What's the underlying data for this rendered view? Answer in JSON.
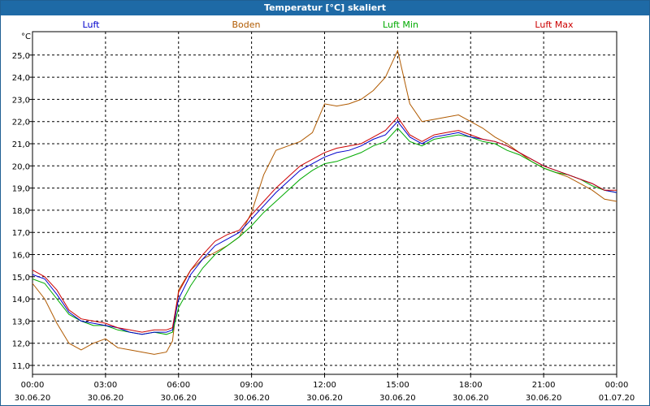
{
  "window": {
    "title": "Temperatur [°C] skaliert"
  },
  "colors": {
    "luft": "#0000cc",
    "boden": "#b05a00",
    "luft_min": "#00aa00",
    "luft_max": "#cc0000"
  },
  "chart_data": {
    "type": "line",
    "title": "Temperatur [°C] skaliert",
    "ylabel": "°C",
    "ylim": [
      10.8,
      26.0
    ],
    "xlim": [
      0,
      24
    ],
    "grid": true,
    "legend_position": "top",
    "y_ticks": [
      "11,0",
      "12,0",
      "13,0",
      "14,0",
      "15,0",
      "16,0",
      "17,0",
      "18,0",
      "19,0",
      "20,0",
      "21,0",
      "22,0",
      "23,0",
      "24,0",
      "25,0"
    ],
    "x_ticks": [
      {
        "time": "00:00",
        "date": "30.06.20"
      },
      {
        "time": "03:00",
        "date": "30.06.20"
      },
      {
        "time": "06:00",
        "date": "30.06.20"
      },
      {
        "time": "09:00",
        "date": "30.06.20"
      },
      {
        "time": "12:00",
        "date": "30.06.20"
      },
      {
        "time": "15:00",
        "date": "30.06.20"
      },
      {
        "time": "18:00",
        "date": "30.06.20"
      },
      {
        "time": "21:00",
        "date": "30.06.20"
      },
      {
        "time": "00:00",
        "date": "01.07.20"
      }
    ],
    "series": [
      {
        "name": "Luft",
        "color": "#0000cc",
        "x": [
          0,
          0.5,
          1.0,
          1.5,
          2.0,
          2.5,
          3.0,
          3.5,
          4.0,
          4.5,
          5.0,
          5.5,
          5.75,
          6.0,
          6.5,
          7.0,
          7.5,
          8.0,
          8.5,
          9.0,
          9.5,
          10.0,
          10.5,
          11.0,
          11.5,
          12.0,
          12.5,
          13.0,
          13.5,
          14.0,
          14.5,
          15.0,
          15.5,
          16.0,
          16.5,
          17.0,
          17.5,
          18.0,
          18.5,
          19.0,
          19.5,
          20.0,
          20.5,
          21.0,
          21.5,
          22.0,
          22.5,
          23.0,
          23.5,
          24.0
        ],
        "y": [
          15.1,
          14.9,
          14.2,
          13.4,
          13.0,
          12.9,
          12.8,
          12.7,
          12.5,
          12.4,
          12.5,
          12.5,
          12.6,
          14.0,
          15.1,
          15.8,
          16.4,
          16.7,
          17.0,
          17.6,
          18.2,
          18.8,
          19.3,
          19.8,
          20.1,
          20.4,
          20.6,
          20.7,
          20.9,
          21.2,
          21.4,
          22.0,
          21.3,
          21.0,
          21.3,
          21.4,
          21.5,
          21.3,
          21.2,
          21.1,
          20.9,
          20.6,
          20.3,
          20.0,
          19.8,
          19.6,
          19.4,
          19.2,
          18.9,
          18.8
        ]
      },
      {
        "name": "Boden",
        "color": "#b05a00",
        "x": [
          0,
          0.5,
          1.0,
          1.5,
          2.0,
          2.5,
          3.0,
          3.5,
          4.0,
          4.5,
          5.0,
          5.5,
          5.75,
          6.0,
          6.5,
          7.0,
          7.5,
          8.0,
          8.5,
          9.0,
          9.5,
          10.0,
          10.5,
          11.0,
          11.5,
          12.0,
          12.5,
          13.0,
          13.5,
          14.0,
          14.5,
          15.0,
          15.5,
          16.0,
          16.5,
          17.0,
          17.5,
          18.0,
          18.5,
          19.0,
          19.5,
          20.0,
          20.5,
          21.0,
          21.5,
          22.0,
          22.5,
          23.0,
          23.5,
          24.0
        ],
        "y": [
          14.7,
          14.0,
          12.9,
          12.0,
          11.7,
          12.0,
          12.2,
          11.8,
          11.7,
          11.6,
          11.5,
          11.6,
          12.1,
          14.4,
          15.3,
          15.8,
          16.1,
          16.4,
          16.8,
          17.9,
          19.6,
          20.7,
          20.9,
          21.1,
          21.5,
          22.8,
          22.7,
          22.8,
          23.0,
          23.4,
          24.0,
          25.2,
          22.8,
          22.0,
          22.1,
          22.2,
          22.3,
          22.0,
          21.7,
          21.3,
          21.0,
          20.6,
          20.2,
          19.9,
          19.7,
          19.5,
          19.2,
          18.9,
          18.5,
          18.4
        ]
      },
      {
        "name": "Luft Min",
        "color": "#00aa00",
        "x": [
          0,
          0.5,
          1.0,
          1.5,
          2.0,
          2.5,
          3.0,
          3.5,
          4.0,
          4.5,
          5.0,
          5.5,
          5.75,
          6.0,
          6.5,
          7.0,
          7.5,
          8.0,
          8.5,
          9.0,
          9.5,
          10.0,
          10.5,
          11.0,
          11.5,
          12.0,
          12.5,
          13.0,
          13.5,
          14.0,
          14.5,
          15.0,
          15.5,
          16.0,
          16.5,
          17.0,
          17.5,
          18.0,
          18.5,
          19.0,
          19.5,
          20.0,
          20.5,
          21.0,
          21.5,
          22.0,
          22.5,
          23.0,
          23.5,
          24.0
        ],
        "y": [
          14.9,
          14.7,
          14.0,
          13.3,
          13.0,
          12.8,
          12.8,
          12.6,
          12.5,
          12.4,
          12.5,
          12.4,
          12.5,
          13.6,
          14.6,
          15.4,
          16.0,
          16.4,
          16.8,
          17.3,
          17.9,
          18.4,
          18.9,
          19.4,
          19.8,
          20.1,
          20.2,
          20.4,
          20.6,
          20.9,
          21.1,
          21.7,
          21.1,
          20.9,
          21.2,
          21.3,
          21.4,
          21.3,
          21.1,
          21.0,
          20.7,
          20.5,
          20.2,
          19.9,
          19.7,
          19.6,
          19.4,
          19.1,
          18.9,
          18.8
        ]
      },
      {
        "name": "Luft Max",
        "color": "#cc0000",
        "x": [
          0,
          0.5,
          1.0,
          1.5,
          2.0,
          2.5,
          3.0,
          3.5,
          4.0,
          4.5,
          5.0,
          5.5,
          5.75,
          6.0,
          6.5,
          7.0,
          7.5,
          8.0,
          8.5,
          9.0,
          9.5,
          10.0,
          10.5,
          11.0,
          11.5,
          12.0,
          12.5,
          13.0,
          13.5,
          14.0,
          14.5,
          15.0,
          15.5,
          16.0,
          16.5,
          17.0,
          17.5,
          18.0,
          18.5,
          19.0,
          19.5,
          20.0,
          20.5,
          21.0,
          21.5,
          22.0,
          22.5,
          23.0,
          23.5,
          24.0
        ],
        "y": [
          15.3,
          15.0,
          14.4,
          13.5,
          13.1,
          13.0,
          12.9,
          12.7,
          12.6,
          12.5,
          12.6,
          12.6,
          12.7,
          14.3,
          15.3,
          16.0,
          16.6,
          16.9,
          17.1,
          17.8,
          18.4,
          19.0,
          19.5,
          20.0,
          20.3,
          20.6,
          20.8,
          20.9,
          21.0,
          21.3,
          21.6,
          22.2,
          21.4,
          21.1,
          21.4,
          21.5,
          21.6,
          21.4,
          21.2,
          21.1,
          20.9,
          20.6,
          20.3,
          20.0,
          19.8,
          19.6,
          19.4,
          19.2,
          18.9,
          18.9
        ]
      }
    ]
  }
}
